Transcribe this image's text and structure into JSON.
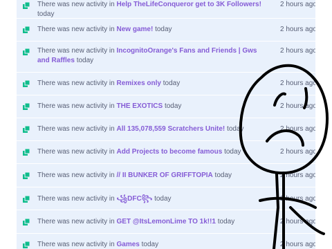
{
  "activity": {
    "prefix": "There was new activity in",
    "items": [
      {
        "studio": "Help TheLifeConqueror get to 3K Followers!",
        "when": "today",
        "ago": "2 hours ago"
      },
      {
        "studio": "New game!",
        "when": "today",
        "ago": "2 hours ago"
      },
      {
        "studio": "IncognitoOrange's Fans and Friends | Gws and Raffles",
        "when": "today",
        "ago": "2 hours ago"
      },
      {
        "studio": "Remixes only",
        "when": "today",
        "ago": "2 hours ago"
      },
      {
        "studio": "THE EXOTICS",
        "when": "today",
        "ago": "2 hours ago"
      },
      {
        "studio": "All 135,078,559 Scratchers Unite!",
        "when": "today",
        "ago": "2 hours ago"
      },
      {
        "studio": "Add Projects to become famous",
        "when": "today",
        "ago": "2 hours ago"
      },
      {
        "studio": "// II BUNKER OF GRIFFTOPIA",
        "when": "today",
        "ago": "2 hours ago"
      },
      {
        "studio": "꧁DFC꧂",
        "when": "today",
        "ago": "2 hours ago"
      },
      {
        "studio": "GET @ItsLemonLime TO 1k!!1",
        "when": "today",
        "ago": "2 hours ago"
      },
      {
        "studio": "Games",
        "when": "today",
        "ago": "2 hours ago"
      }
    ]
  },
  "icon_name": "studio-icon",
  "colors": {
    "link": "#855cd6",
    "text": "#575e75",
    "icon": "#0fbd8c",
    "row_bg": "#e9f1fc",
    "doodle": "#000000"
  }
}
